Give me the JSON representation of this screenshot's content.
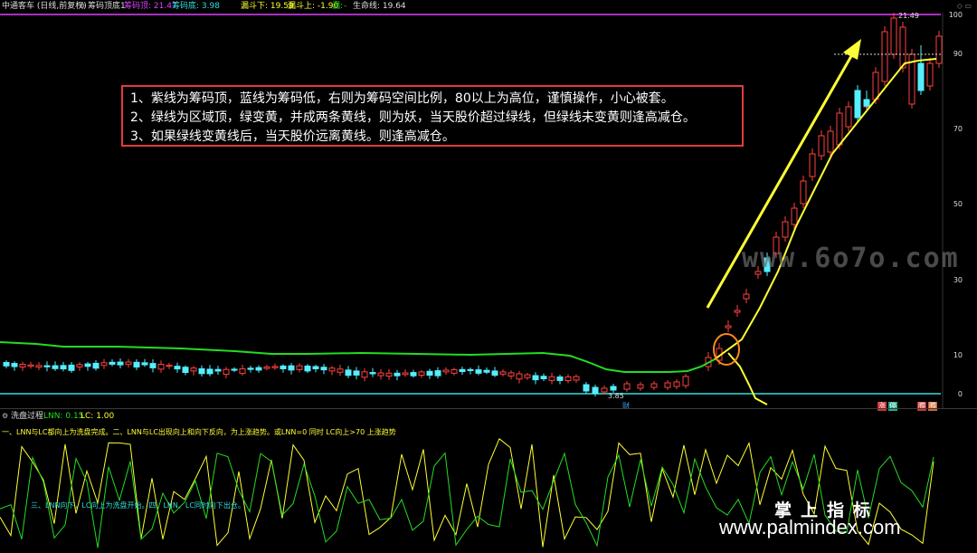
{
  "header": {
    "stock": "中通客车 (日线,前复权)",
    "indicator": "筹码顶底1",
    "top_label": "筹码顶: 21.47",
    "bottom_label": "筹码底: 3.98",
    "lou_down": "漏斗下: 19.59",
    "lou_up": "漏斗上: -1.90",
    "lou_kong": "漏:",
    "lou_kong_val": "-",
    "life_line": "生命线: 19.64"
  },
  "axis": {
    "ticks": [
      "100",
      "90",
      "70",
      "50",
      "30",
      "10",
      "0"
    ],
    "high_label": "21.49",
    "low_label": "3.85"
  },
  "note": {
    "line1": "1、紫线为筹码顶，蓝线为筹码低，右则为筹码空间比例，80以上为高位，谨慎操作，小心被套。",
    "line2": "2、绿线为区域顶，绿变黄，并成两条黄线，则为妖，当天股价超过绿线，但绿线未变黄则逢高减仓。",
    "line3": "3、如果绿线变黄线后，当天股价远离黄线。则逢高减仓。"
  },
  "chips": {
    "c1": "财",
    "c2": "涨",
    "c3": "停",
    "c4": "腾",
    "c5": "腾"
  },
  "sub": {
    "title": "洗盘过程",
    "lnn": "LNN: 0.15",
    "lc": "LC: 1.00",
    "note1": "一、LNN与LC都向上为洗盘完成。二、LNN与LC出现向上和向下反向，为上涨趋势。或LNN=0 同时 LC向上>70 上涨趋势",
    "note2": "三、LNN向下，LC向上为洗盘开始。四、LNN、LC同时向下出仓。"
  },
  "watermark": {
    "site1": "www.6o7o.com",
    "cn": "掌上指标",
    "site2": "www.palmindex.com"
  },
  "colors": {
    "purple": "#e040ff",
    "cyan": "#33dddd",
    "green": "#22dd22",
    "yellow": "#ffff33",
    "up": "#ff4040",
    "down": "#55eeff"
  }
}
